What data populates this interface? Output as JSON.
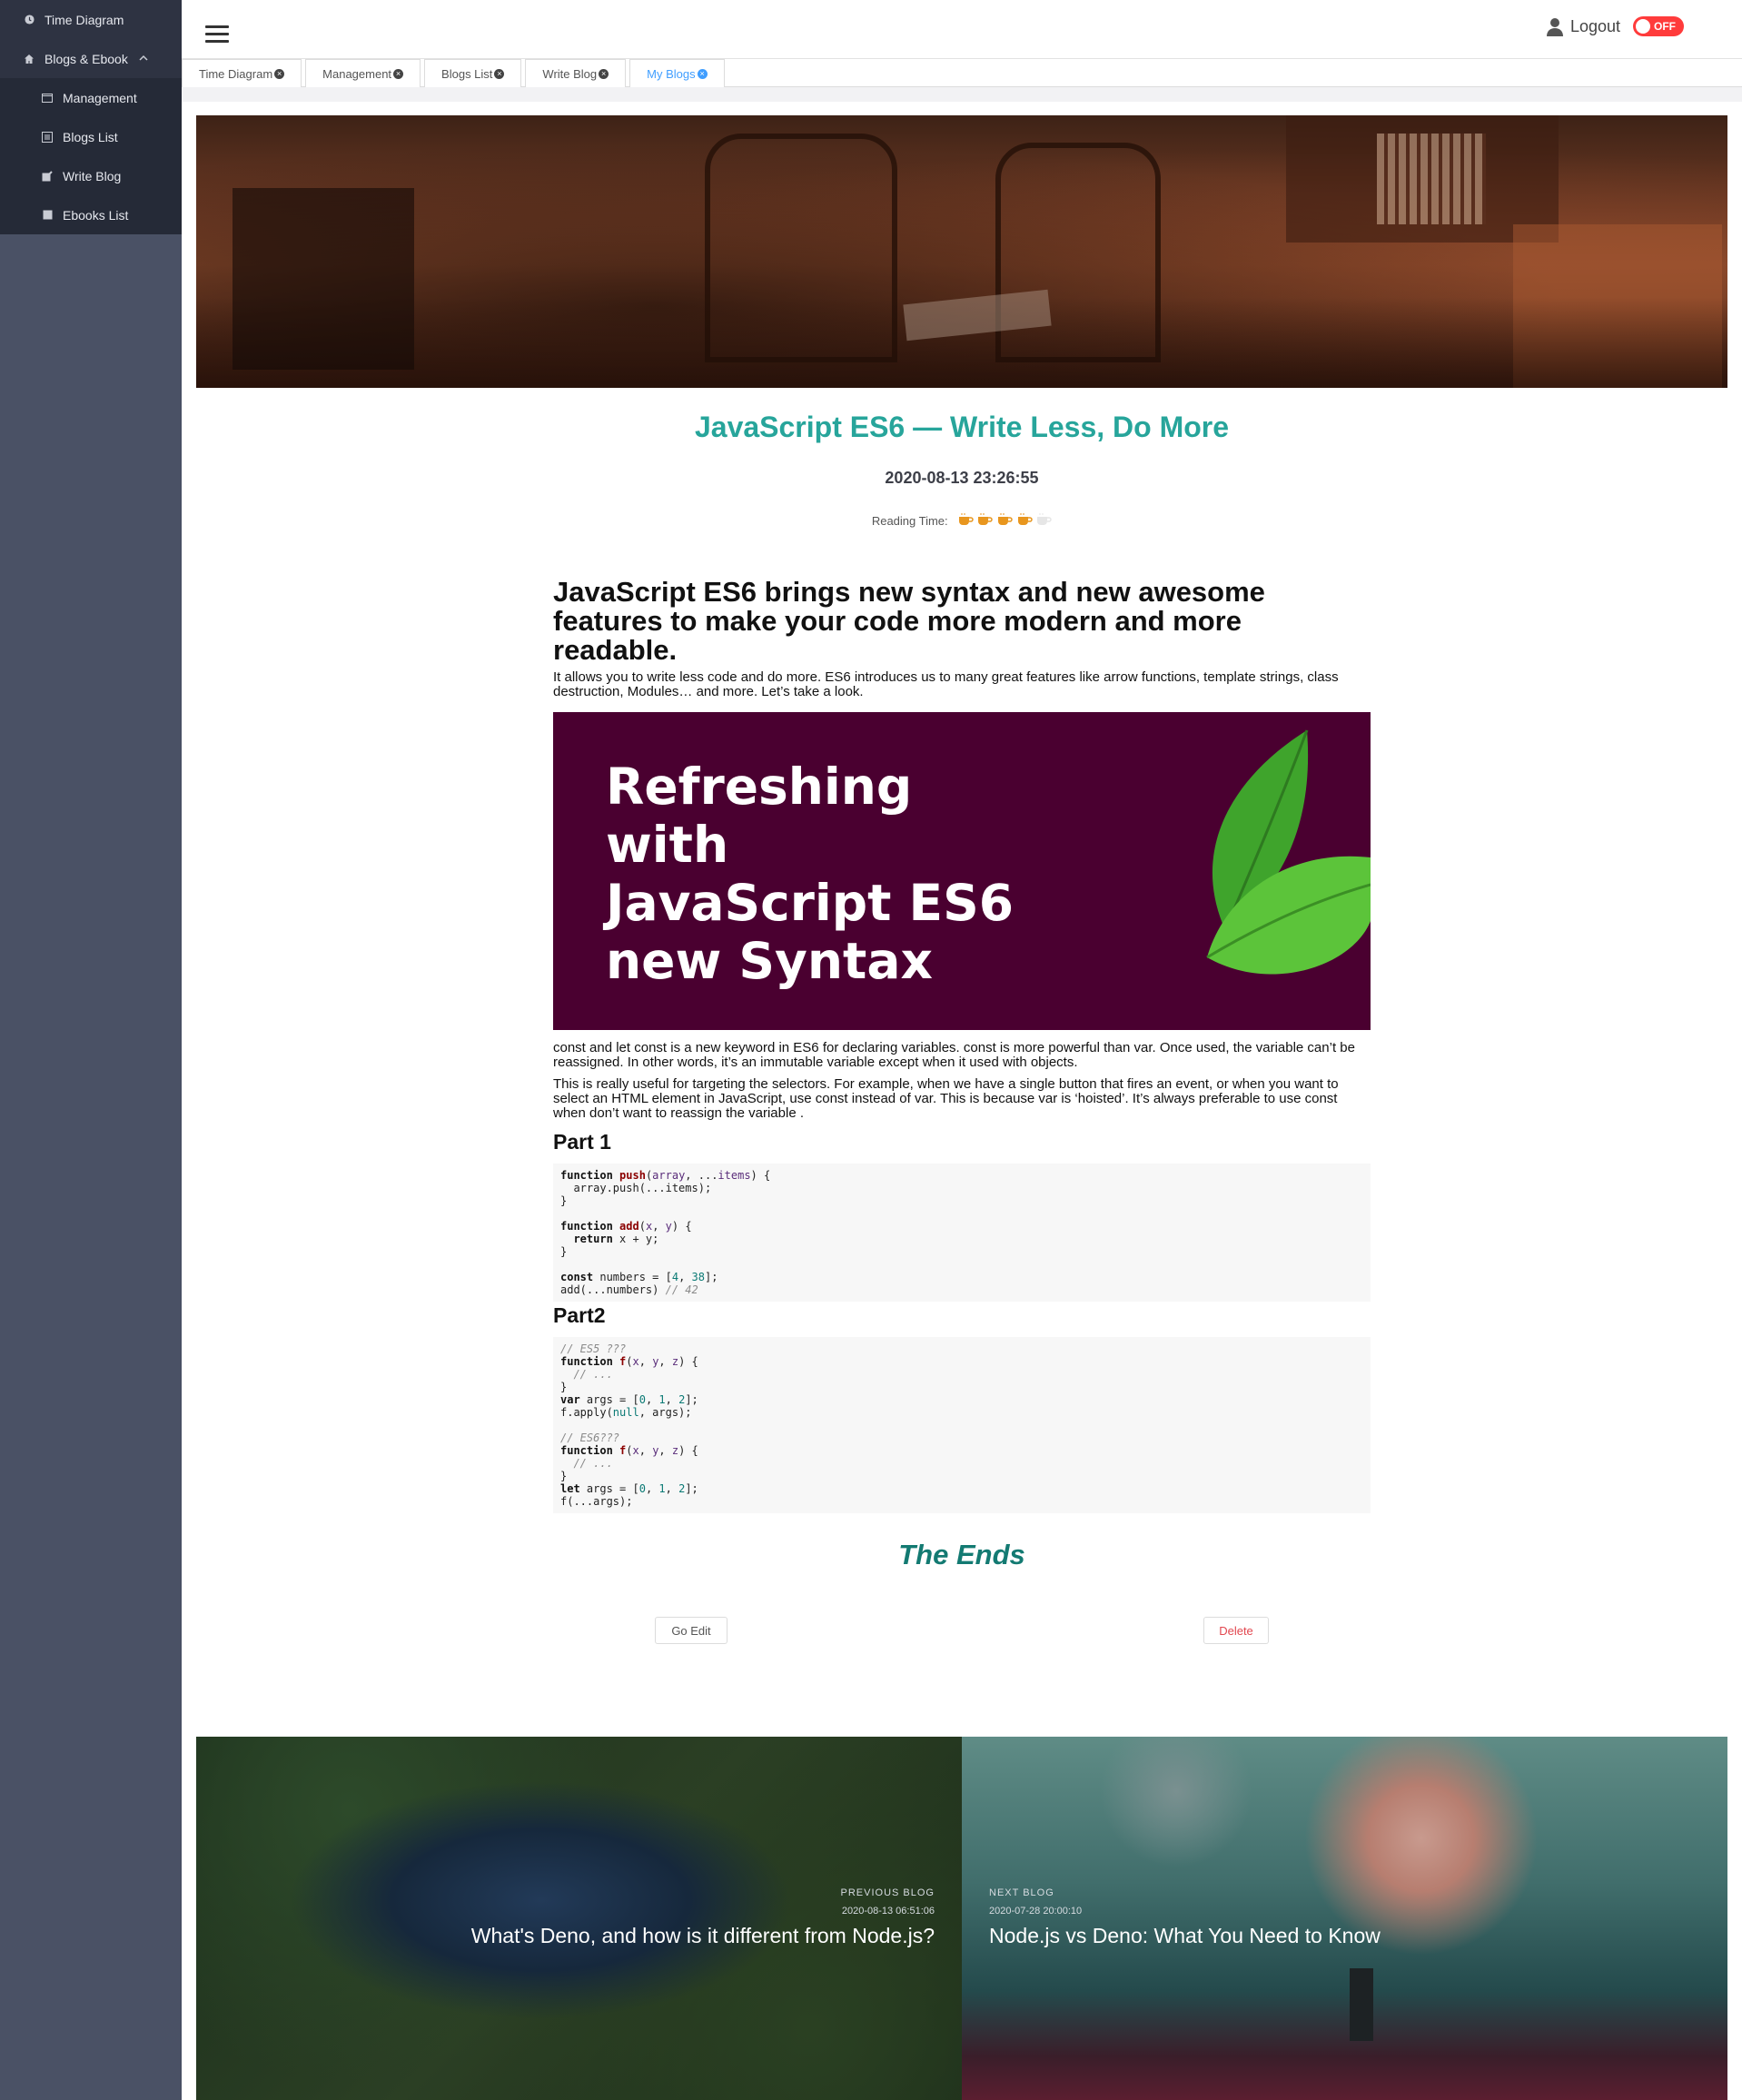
{
  "sidebar": {
    "items": [
      {
        "label": "Time Diagram",
        "icon": "clock-icon"
      },
      {
        "label": "Blogs & Ebook",
        "icon": "home-icon"
      }
    ],
    "sub_items": [
      {
        "label": "Management",
        "icon": "folder-icon"
      },
      {
        "label": "Blogs List",
        "icon": "list-icon"
      },
      {
        "label": "Write Blog",
        "icon": "edit-icon"
      },
      {
        "label": "Ebooks List",
        "icon": "book-icon"
      }
    ]
  },
  "header": {
    "logout_label": "Logout",
    "toggle_label": "OFF",
    "toggle_color": "#ff3b3b"
  },
  "tabs": [
    {
      "label": "Time Diagram",
      "active": false
    },
    {
      "label": "Management",
      "active": false
    },
    {
      "label": "Blogs List",
      "active": false
    },
    {
      "label": "Write Blog",
      "active": false
    },
    {
      "label": "My Blogs",
      "active": true
    }
  ],
  "post": {
    "title": "JavaScript ES6 — Write Less, Do More",
    "date": "2020-08-13 23:26:55",
    "reading_label": "Reading Time:",
    "reading_cups_filled": 4,
    "reading_cups_total": 5,
    "heading": "JavaScript ES6 brings new syntax and new awesome features to make your code more modern and more readable.",
    "intro": "It allows you to write less code and do more. ES6 introduces us to many great features like arrow functions, template strings, class destruction, Modules… and more. Let’s take a look.",
    "banner_text": "Refreshing\nwith\nJavaScript ES6\nnew Syntax",
    "para1": "const and let const is a new keyword in ES6 for declaring variables. const is more powerful than var. Once used, the variable can’t be reassigned. In other words, it’s an immutable variable except when it used with objects.",
    "para2": "This is really useful for targeting the selectors. For example, when we have a single button that fires an event, or when you want to select an HTML element in JavaScript, use const instead of var. This is because var is ‘hoisted’. It’s always preferable to use const when don’t want to reassign the variable .",
    "part1_title": "Part 1",
    "part2_title": "Part2",
    "ends": "The Ends",
    "edit_label": "Go Edit",
    "delete_label": "Delete",
    "title_color": "#27a59b"
  },
  "nav": {
    "prev": {
      "label": "PREVIOUS BLOG",
      "date": "2020-08-13 06:51:06",
      "title": "What's Deno, and how is it different from Node.js?"
    },
    "next": {
      "label": "NEXT BLOG",
      "date": "2020-07-28 20:00:10",
      "title": "Node.js vs Deno: What You Need to Know"
    }
  }
}
